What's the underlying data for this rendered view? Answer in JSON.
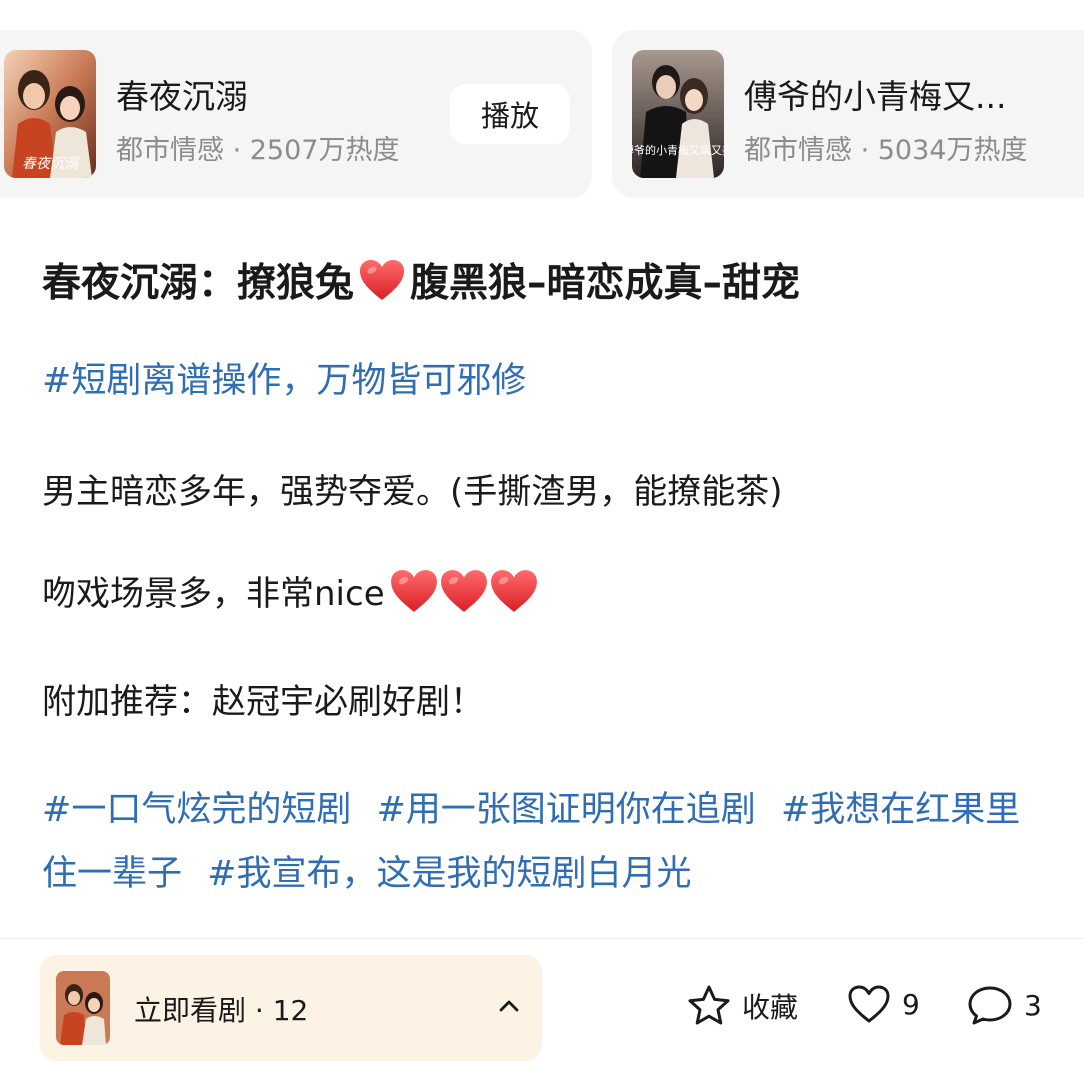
{
  "cards": [
    {
      "title": "春夜沉溺",
      "meta": "都市情感 · 2507万热度",
      "play_label": "播放",
      "poster_text": "春夜沉溺"
    },
    {
      "title": "傅爷的小青梅又...",
      "meta": "都市情感 · 5034万热度",
      "poster_text": "傅爷的小青梅又飒又美"
    }
  ],
  "post": {
    "title_part1": "春夜沉溺：撩狼兔",
    "title_part2": "腹黑狼–暗恋成真–甜宠",
    "hashtag": "#短剧离谱操作，万物皆可邪修",
    "line1": "男主暗恋多年，强势夺爱。(手撕渣男，能撩能茶)",
    "line2": "吻戏场景多，非常nice",
    "line3": "附加推荐：赵冠宇必刷好剧！",
    "tags": [
      "#一口气炫完的短剧",
      "#用一张图证明你在追剧",
      "#我想在红果里住一辈子",
      "#我宣布，这是我的短剧白月光"
    ]
  },
  "bottom_bar": {
    "watch_label": "立即看剧 · 12",
    "favorite_label": "收藏",
    "like_count": "9",
    "comment_count": "3"
  },
  "colors": {
    "hashtag_blue": "#2f6db5",
    "heart_red": "#e8353a",
    "watch_bg": "#fdf3e4",
    "card_bg": "#f5f5f5"
  }
}
